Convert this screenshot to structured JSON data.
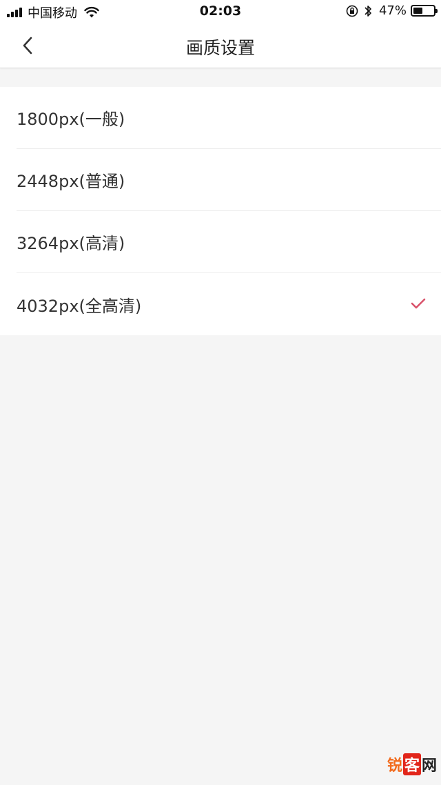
{
  "status_bar": {
    "carrier": "中国移动",
    "time": "02:03",
    "battery_percent": "47%",
    "battery_level": 0.47,
    "icons": [
      "signal-icon",
      "wifi-icon",
      "orientation-lock-icon",
      "bluetooth-icon",
      "battery-icon"
    ]
  },
  "nav": {
    "title": "画质设置",
    "back_icon": "chevron-left-icon"
  },
  "options": [
    {
      "label": "1800px(一般)",
      "selected": false
    },
    {
      "label": "2448px(普通)",
      "selected": false
    },
    {
      "label": "3264px(高清)",
      "selected": false
    },
    {
      "label": "4032px(全高清)",
      "selected": true
    }
  ],
  "colors": {
    "accent_check": "#d9536b",
    "background": "#f5f5f5",
    "surface": "#ffffff"
  },
  "watermark": {
    "part1": "锐",
    "part2": "客",
    "part3": "网"
  }
}
